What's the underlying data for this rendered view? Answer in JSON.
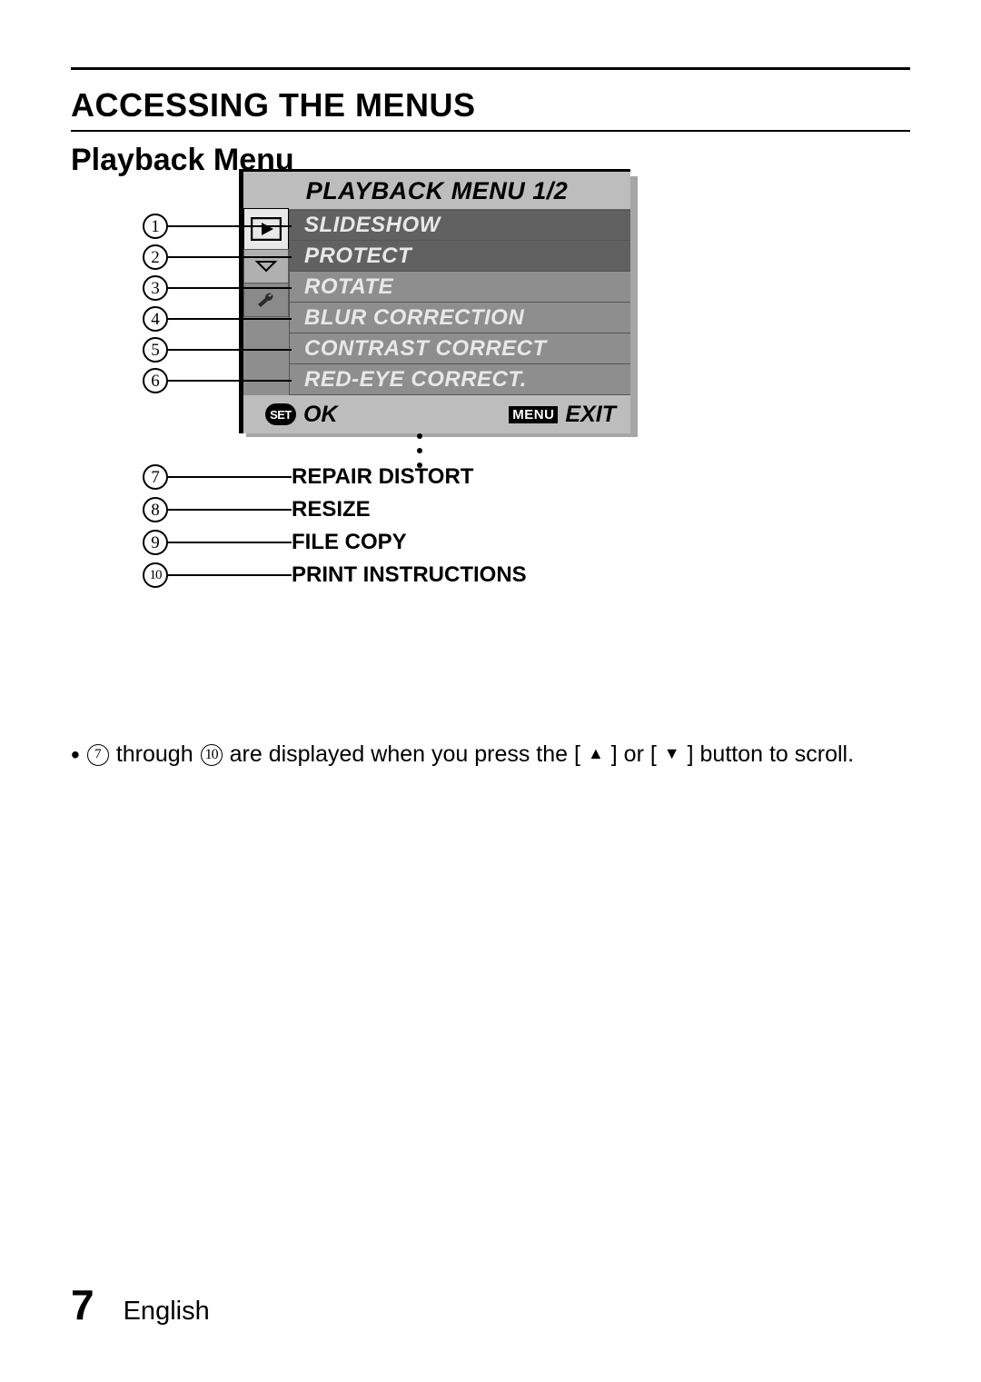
{
  "heading": "ACCESSING THE MENUS",
  "subheading": "Playback Menu",
  "screen": {
    "title": "PLAYBACK MENU 1/2",
    "items": [
      {
        "n": "1",
        "label": "SLIDESHOW",
        "selected": true
      },
      {
        "n": "2",
        "label": "PROTECT",
        "selected": false
      },
      {
        "n": "3",
        "label": "ROTATE",
        "selected": false
      },
      {
        "n": "4",
        "label": "BLUR CORRECTION",
        "selected": false
      },
      {
        "n": "5",
        "label": "CONTRAST CORRECT",
        "selected": false
      },
      {
        "n": "6",
        "label": "RED-EYE CORRECT.",
        "selected": false
      }
    ],
    "set_badge": "SET",
    "ok_label": "OK",
    "menu_badge": "MENU",
    "exit_label": "EXIT"
  },
  "extra_items": [
    {
      "n": "7",
      "label": "REPAIR DISTORT"
    },
    {
      "n": "8",
      "label": "RESIZE"
    },
    {
      "n": "9",
      "label": "FILE COPY"
    },
    {
      "n": "10",
      "label": "PRINT INSTRUCTIONS"
    }
  ],
  "note": {
    "n_from": "7",
    "n_to": "10",
    "prefix_after_from": " through ",
    "text_after_to": " are displayed when you press the [",
    "mid": "] or [",
    "suffix": "] button to scroll."
  },
  "footer": {
    "page": "7",
    "language": "English"
  }
}
